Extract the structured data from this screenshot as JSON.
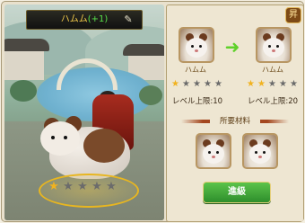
{
  "pet": {
    "name": "ハムム",
    "level_tag": "(+1)"
  },
  "ground_star_count": 5,
  "upgrade": {
    "current": {
      "name": "ハムム",
      "stars": 5,
      "filled": 1,
      "limit_label": "レベル上限:10"
    },
    "next": {
      "name": "ハムム",
      "stars": 5,
      "filled": 2,
      "limit_label": "レベル上限:20"
    },
    "materials_title": "所要材料",
    "materials": [
      "ハムム",
      "ハムム"
    ],
    "button_label": "進級"
  },
  "corner_badge": "昇",
  "colors": {
    "star_filled": "#f1b21f",
    "star_empty": "#6b6b6b",
    "button": "#3da83a",
    "arrow": "#5fd12a"
  }
}
